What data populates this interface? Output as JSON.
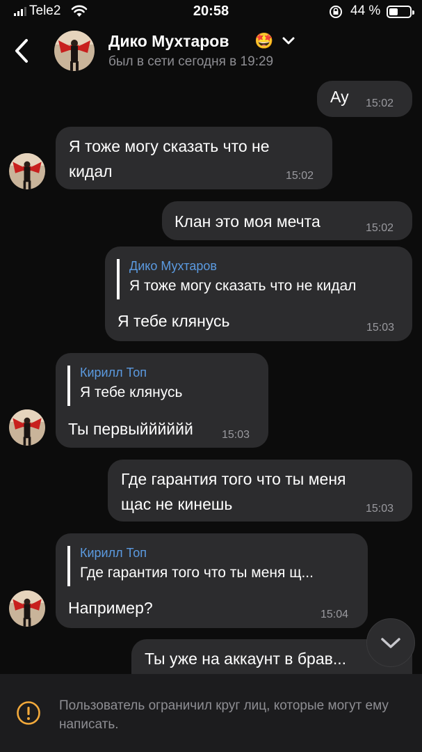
{
  "status_bar": {
    "carrier": "Tele2",
    "time": "20:58",
    "battery_pct": "44 %",
    "battery_level": 0.44
  },
  "header": {
    "contact_name": "Дико Мухтаров",
    "name_emoji": "🤩",
    "last_seen": "был в сети сегодня в 19:29"
  },
  "messages": [
    {
      "direction": "out",
      "text": "Ау",
      "time": "15:02"
    },
    {
      "direction": "in",
      "text_lines": [
        "Я тоже могу сказать что не",
        "кидал"
      ],
      "time": "15:02"
    },
    {
      "direction": "out",
      "text": "Клан это моя мечта",
      "time": "15:02"
    },
    {
      "direction": "out",
      "reply_name": "Дико Мухтаров",
      "reply_text": "Я тоже могу сказать что не кидал",
      "text": "Я тебе клянусь",
      "time": "15:03"
    },
    {
      "direction": "in",
      "reply_name": "Кирилл Топ",
      "reply_text": "Я тебе клянусь",
      "text": "Ты первыйййййй",
      "time": "15:03"
    },
    {
      "direction": "out",
      "text_lines": [
        "Где гарантия того что ты меня",
        "щас не кинешь"
      ],
      "time": "15:03"
    },
    {
      "direction": "in",
      "reply_name": "Кирилл Топ",
      "reply_text": "Где гарантия того что ты меня щ...",
      "text": "Например?",
      "time": "15:04"
    },
    {
      "direction": "out",
      "text": "Ты уже на аккаунт в брав..."
    }
  ],
  "footer": {
    "notice": "Пользователь ограничил круг лиц, которые могут ему написать."
  },
  "colors": {
    "background": "#0c0c0c",
    "bubble": "#2c2c2e",
    "reply_name": "#5b9ae0",
    "muted": "#8e8e93"
  },
  "icons": [
    "signal-icon",
    "wifi-icon",
    "rotation-lock-icon",
    "battery-icon",
    "back-chevron-icon",
    "chevron-down-icon",
    "scroll-down-icon",
    "warning-icon"
  ]
}
